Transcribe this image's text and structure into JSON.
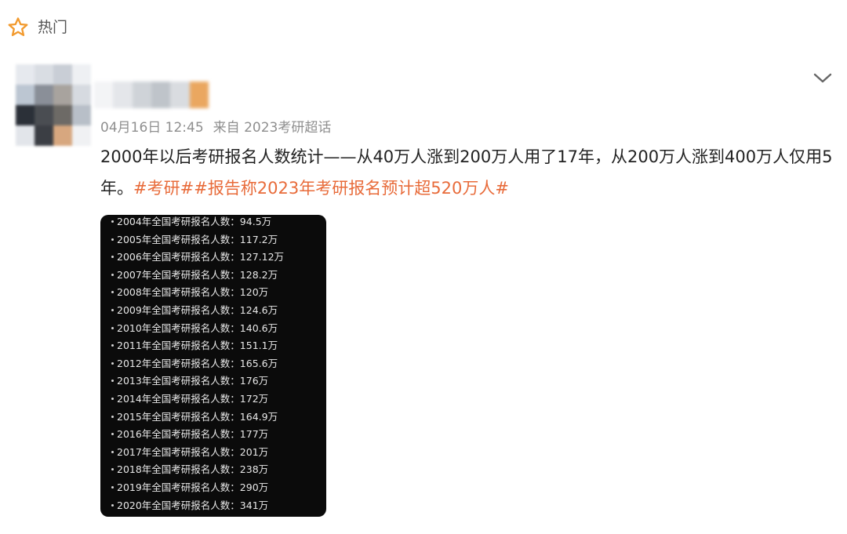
{
  "header": {
    "hot_label": "热门",
    "star_icon": "star-outline-icon",
    "star_color": "#f29a2e"
  },
  "post": {
    "timestamp": "04月16日 12:45",
    "source": "来自 2023考研超话",
    "text_plain": "2000年以后考研报名人数统计——从40万人涨到200万人用了17年，从200万人涨到400万人仅用5年。",
    "topics": [
      "#考研#",
      "#报告称2023年考研报名预计超520万人#"
    ],
    "topic_color": "#e86b3a",
    "expand_icon": "chevron-down-icon"
  },
  "image": {
    "rows": [
      "2004年全国考研报名人数：94.5万",
      "2005年全国考研报名人数：117.2万",
      "2006年全国考研报名人数：127.12万",
      "2007年全国考研报名人数：128.2万",
      "2008年全国考研报名人数：120万",
      "2009年全国考研报名人数：124.6万",
      "2010年全国考研报名人数：140.6万",
      "2011年全国考研报名人数：151.1万",
      "2012年全国考研报名人数：165.6万",
      "2013年全国考研报名人数：176万",
      "2014年全国考研报名人数：172万",
      "2015年全国考研报名人数：164.9万",
      "2016年全国考研报名人数：177万",
      "2017年全国考研报名人数：201万",
      "2018年全国考研报名人数：238万",
      "2019年全国考研报名人数：290万",
      "2020年全国考研报名人数：341万"
    ]
  },
  "colors": {
    "avatar_blur": [
      "#e6e9ee",
      "#d9dde3",
      "#c9ced6",
      "#eef0f3",
      "#bcc6d2",
      "#8a8f98",
      "#a8a39e",
      "#d6dae0",
      "#2b3038",
      "#4a4d52",
      "#6d6a66",
      "#b8bfc8",
      "#e2e5ea",
      "#3b3e44",
      "#d7a77f",
      "#f0f1f3"
    ],
    "username_blur": [
      "#f3f4f6",
      "#e4e6ea",
      "#cfd3d8",
      "#bfc4ca",
      "#d9dce0",
      "#eaa760"
    ]
  }
}
